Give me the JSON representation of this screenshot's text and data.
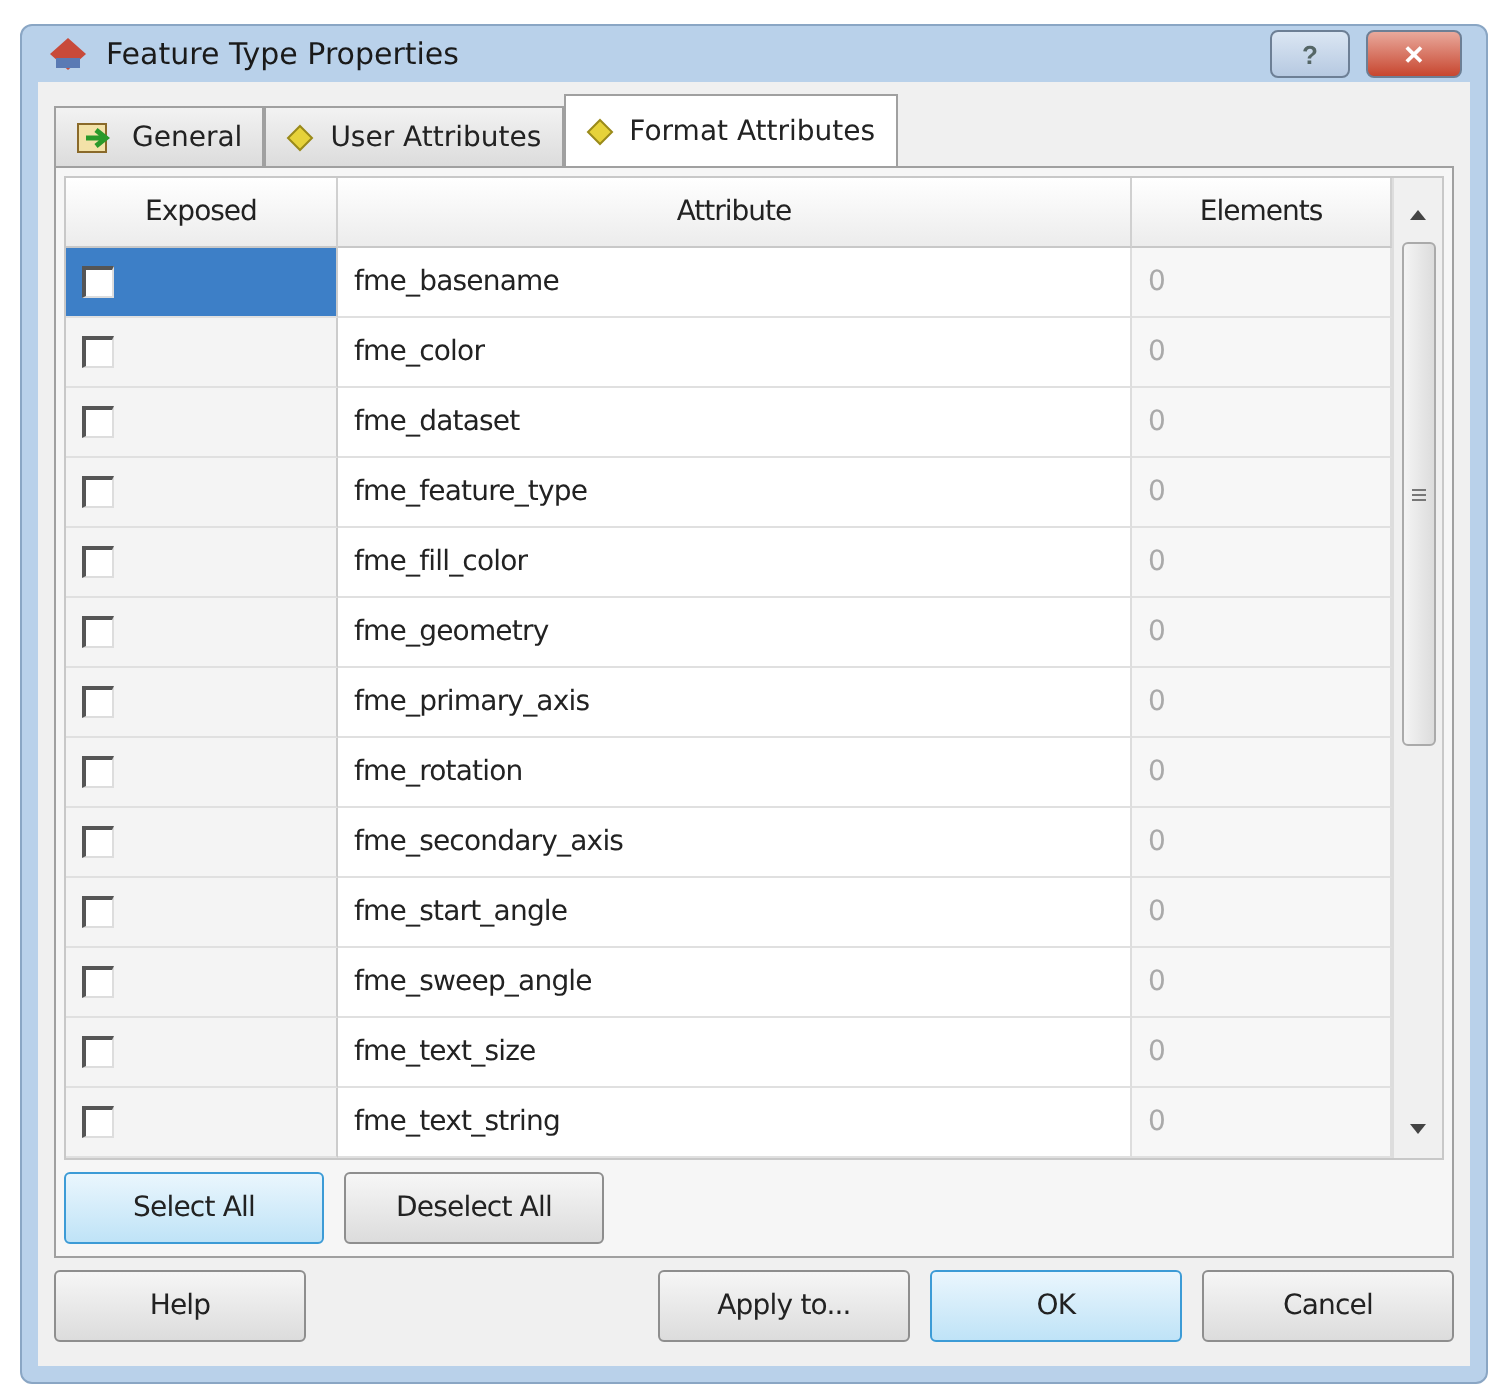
{
  "window": {
    "title": "Feature Type Properties",
    "help_button": "?",
    "close_button": "✕"
  },
  "tabs": [
    {
      "label": "General",
      "kind": "general",
      "selected": false
    },
    {
      "label": "User Attributes",
      "kind": "attributes",
      "selected": false
    },
    {
      "label": "Format Attributes",
      "kind": "attributes",
      "selected": true
    }
  ],
  "table": {
    "columns": [
      "Exposed",
      "Attribute",
      "Elements"
    ],
    "rows": [
      {
        "exposed": false,
        "attribute": "fme_basename",
        "elements": "0",
        "selected": true
      },
      {
        "exposed": false,
        "attribute": "fme_color",
        "elements": "0",
        "selected": false
      },
      {
        "exposed": false,
        "attribute": "fme_dataset",
        "elements": "0",
        "selected": false
      },
      {
        "exposed": false,
        "attribute": "fme_feature_type",
        "elements": "0",
        "selected": false
      },
      {
        "exposed": false,
        "attribute": "fme_fill_color",
        "elements": "0",
        "selected": false
      },
      {
        "exposed": false,
        "attribute": "fme_geometry",
        "elements": "0",
        "selected": false
      },
      {
        "exposed": false,
        "attribute": "fme_primary_axis",
        "elements": "0",
        "selected": false
      },
      {
        "exposed": false,
        "attribute": "fme_rotation",
        "elements": "0",
        "selected": false
      },
      {
        "exposed": false,
        "attribute": "fme_secondary_axis",
        "elements": "0",
        "selected": false
      },
      {
        "exposed": false,
        "attribute": "fme_start_angle",
        "elements": "0",
        "selected": false
      },
      {
        "exposed": false,
        "attribute": "fme_sweep_angle",
        "elements": "0",
        "selected": false
      },
      {
        "exposed": false,
        "attribute": "fme_text_size",
        "elements": "0",
        "selected": false
      },
      {
        "exposed": false,
        "attribute": "fme_text_string",
        "elements": "0",
        "selected": false
      }
    ]
  },
  "tab_buttons": [
    {
      "label": "Select All",
      "default": true
    },
    {
      "label": "Deselect All",
      "default": false
    }
  ],
  "footer_buttons": [
    {
      "label": "Help",
      "default": false
    },
    {
      "label": "Apply to...",
      "default": false
    },
    {
      "label": "OK",
      "default": true
    },
    {
      "label": "Cancel",
      "default": false
    }
  ]
}
